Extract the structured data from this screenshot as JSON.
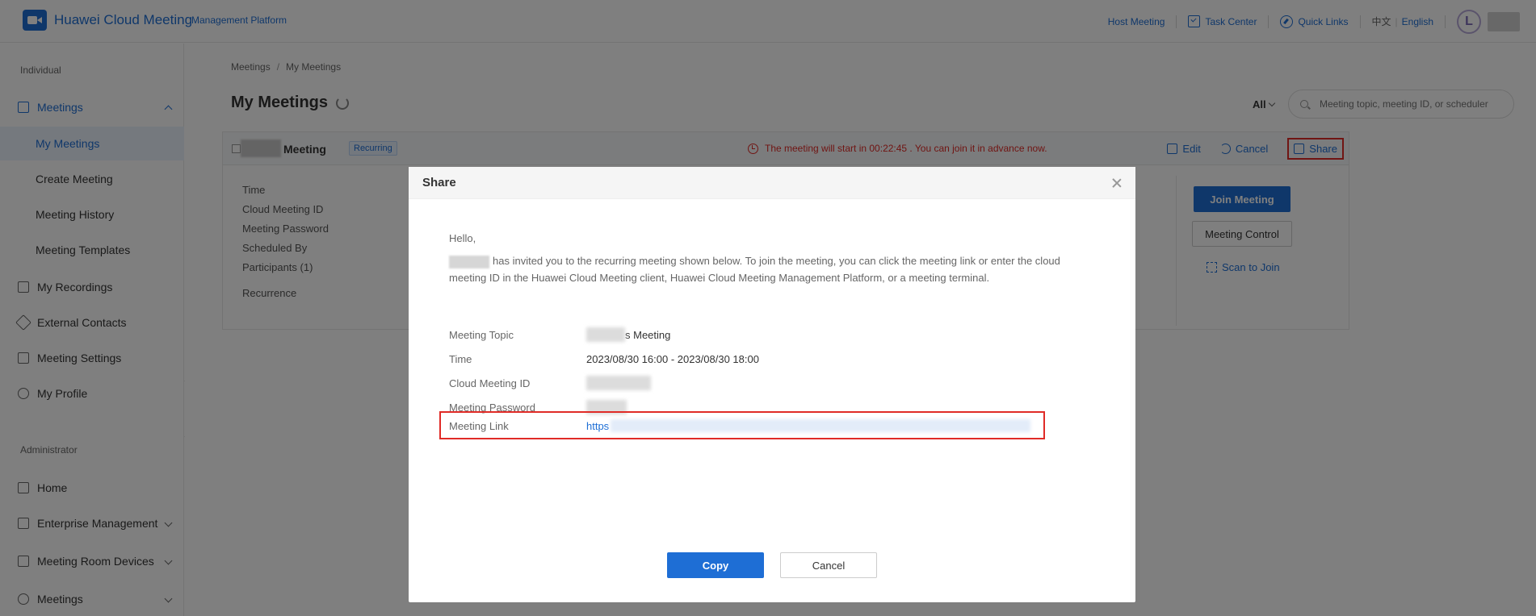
{
  "header": {
    "brand": "Huawei Cloud Meeting",
    "brand_sub": "Management Platform",
    "host_meeting": "Host Meeting",
    "task_center": "Task Center",
    "quick_links": "Quick Links",
    "lang_cn": "中文",
    "lang_en": "English",
    "avatar_letter": "L"
  },
  "sidebar": {
    "group_individual": "Individual",
    "meetings": "Meetings",
    "my_meetings": "My Meetings",
    "create_meeting": "Create Meeting",
    "meeting_history": "Meeting History",
    "meeting_templates": "Meeting Templates",
    "my_recordings": "My Recordings",
    "external_contacts": "External Contacts",
    "meeting_settings": "Meeting Settings",
    "my_profile": "My Profile",
    "group_admin": "Administrator",
    "home": "Home",
    "enterprise_management": "Enterprise Management",
    "meeting_room_devices": "Meeting Room Devices",
    "meetings_admin": "Meetings"
  },
  "main": {
    "breadcrumb_root": "Meetings",
    "breadcrumb_current": "My Meetings",
    "title": "My Meetings",
    "filter": "All",
    "search_placeholder": "Meeting topic, meeting ID, or scheduler"
  },
  "card": {
    "name": "Meeting",
    "badge": "Recurring",
    "notice": "The meeting will start in 00:22:45 . You can join it in advance now.",
    "edit": "Edit",
    "cancel": "Cancel",
    "share": "Share",
    "labels": [
      "Time",
      "Cloud Meeting ID",
      "Meeting Password",
      "Scheduled By",
      "Participants (1)",
      "Recurrence"
    ],
    "join": "Join Meeting",
    "control": "Meeting Control",
    "scan": "Scan to Join"
  },
  "dialog": {
    "title": "Share",
    "hello": "Hello,",
    "invite": "has invited you to the recurring meeting shown below. To join the meeting, you can click the meeting link or enter the cloud meeting ID in the Huawei Cloud Meeting client, Huawei Cloud Meeting Management Platform, or a meeting terminal.",
    "rows": {
      "topic_label": "Meeting Topic",
      "topic_value": "s Meeting",
      "time_label": "Time",
      "time_value": "2023/08/30 16:00 - 2023/08/30 18:00",
      "id_label": "Cloud Meeting ID",
      "password_label": "Meeting Password",
      "link_label": "Meeting Link",
      "link_value": "https"
    },
    "copy": "Copy",
    "cancel": "Cancel"
  },
  "colors": {
    "accent": "#1e6ed5",
    "alert": "#e02b27"
  }
}
